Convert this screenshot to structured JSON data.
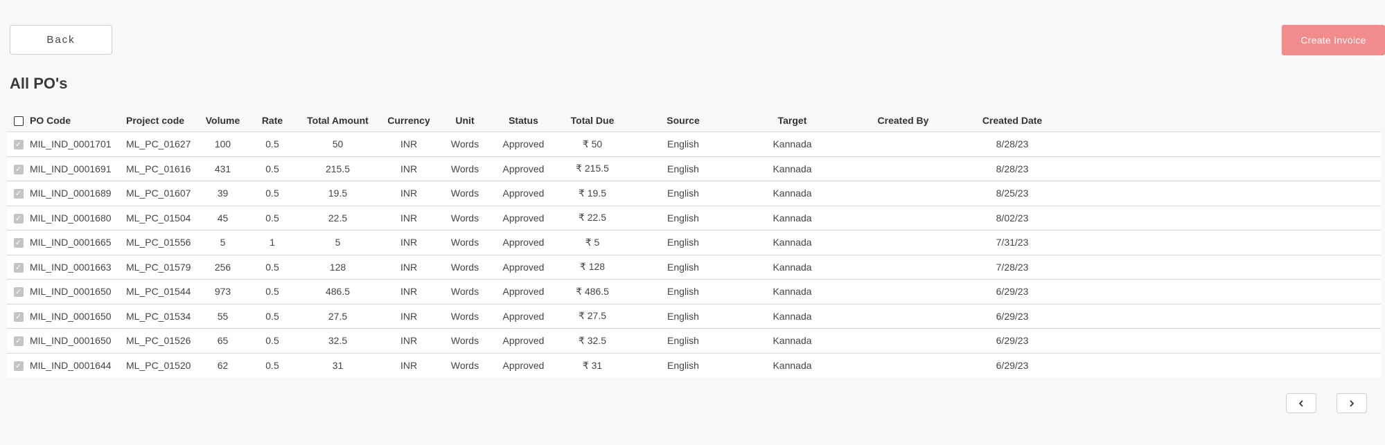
{
  "header": {
    "back_label": "Back",
    "create_invoice_label": "Create Invoice",
    "page_title": "All PO's"
  },
  "table": {
    "columns": [
      "PO Code",
      "Project code",
      "Volume",
      "Rate",
      "Total Amount",
      "Currency",
      "Unit",
      "Status",
      "Total Due",
      "Source",
      "Target",
      "Created By",
      "Created Date"
    ],
    "rows": [
      {
        "checked": true,
        "cells": [
          "MIL_IND_0001701",
          "ML_PC_01627",
          "100",
          "0.5",
          "50",
          "INR",
          "Words",
          "Approved",
          "₹ 50",
          "English",
          "Kannada",
          "",
          "8/28/23"
        ]
      },
      {
        "checked": true,
        "cells": [
          "MIL_IND_0001691",
          "ML_PC_01616",
          "431",
          "0.5",
          "215.5",
          "INR",
          "Words",
          "Approved",
          "₹ 215.5",
          "English",
          "Kannada",
          "",
          "8/28/23"
        ]
      },
      {
        "checked": true,
        "cells": [
          "MIL_IND_0001689",
          "ML_PC_01607",
          "39",
          "0.5",
          "19.5",
          "INR",
          "Words",
          "Approved",
          "₹ 19.5",
          "English",
          "Kannada",
          "",
          "8/25/23"
        ]
      },
      {
        "checked": true,
        "cells": [
          "MIL_IND_0001680",
          "ML_PC_01504",
          "45",
          "0.5",
          "22.5",
          "INR",
          "Words",
          "Approved",
          "₹ 22.5",
          "English",
          "Kannada",
          "",
          "8/02/23"
        ]
      },
      {
        "checked": true,
        "cells": [
          "MIL_IND_0001665",
          "ML_PC_01556",
          "5",
          "1",
          "5",
          "INR",
          "Words",
          "Approved",
          "₹ 5",
          "English",
          "Kannada",
          "",
          "7/31/23"
        ]
      },
      {
        "checked": true,
        "cells": [
          "MIL_IND_0001663",
          "ML_PC_01579",
          "256",
          "0.5",
          "128",
          "INR",
          "Words",
          "Approved",
          "₹ 128",
          "English",
          "Kannada",
          "",
          "7/28/23"
        ]
      },
      {
        "checked": true,
        "cells": [
          "MIL_IND_0001650",
          "ML_PC_01544",
          "973",
          "0.5",
          "486.5",
          "INR",
          "Words",
          "Approved",
          "₹ 486.5",
          "English",
          "Kannada",
          "",
          "6/29/23"
        ]
      },
      {
        "checked": true,
        "cells": [
          "MIL_IND_0001650",
          "ML_PC_01534",
          "55",
          "0.5",
          "27.5",
          "INR",
          "Words",
          "Approved",
          "₹ 27.5",
          "English",
          "Kannada",
          "",
          "6/29/23"
        ]
      },
      {
        "checked": true,
        "cells": [
          "MIL_IND_0001650",
          "ML_PC_01526",
          "65",
          "0.5",
          "32.5",
          "INR",
          "Words",
          "Approved",
          "₹ 32.5",
          "English",
          "Kannada",
          "",
          "6/29/23"
        ]
      },
      {
        "checked": true,
        "cells": [
          "MIL_IND_0001644",
          "ML_PC_01520",
          "62",
          "0.5",
          "31",
          "INR",
          "Words",
          "Approved",
          "₹ 31",
          "English",
          "Kannada",
          "",
          "6/29/23"
        ]
      }
    ]
  },
  "pagination": {
    "prev_icon": "chevron-left-icon",
    "next_icon": "chevron-right-icon"
  },
  "colors": {
    "page_background": "#f8f8f8",
    "create_button": "#f28b8c",
    "checked_box": "#c4c4c4"
  }
}
